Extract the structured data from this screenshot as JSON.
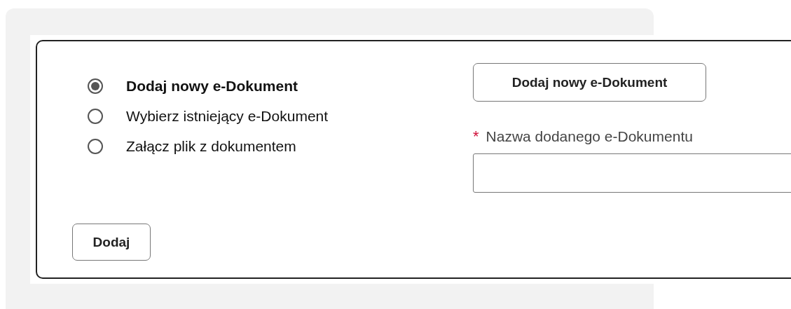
{
  "options": [
    {
      "label": "Dodaj nowy e-Dokument",
      "selected": true
    },
    {
      "label": "Wybierz istniejący e-Dokument",
      "selected": false
    },
    {
      "label": "Załącz plik z dokumentem",
      "selected": false
    }
  ],
  "add_new_button": "Dodaj nowy e-Dokument",
  "name_field": {
    "required_mark": "*",
    "label": "Nazwa dodanego e-Dokumentu"
  },
  "submit_button": "Dodaj"
}
